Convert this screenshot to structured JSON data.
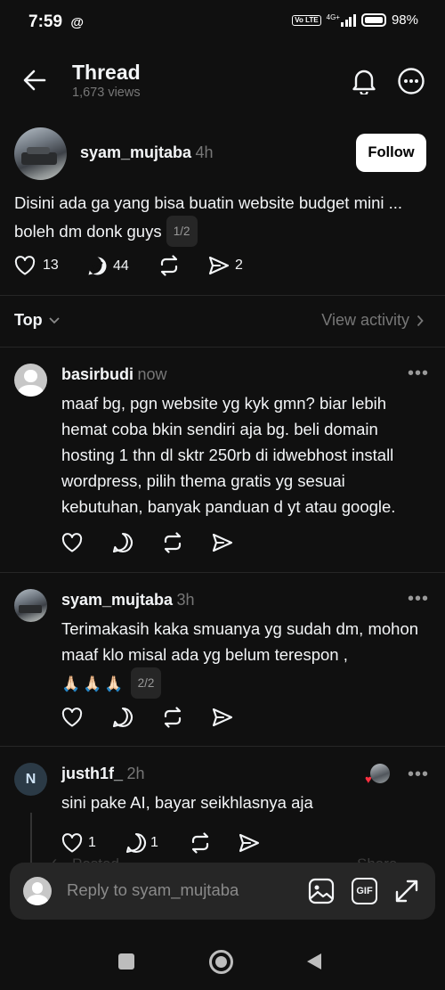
{
  "status_bar": {
    "time": "7:59",
    "network": "4G+",
    "volte": "Vo LTE",
    "battery": "98%"
  },
  "header": {
    "title": "Thread",
    "views": "1,673 views"
  },
  "post": {
    "username": "syam_mujtaba",
    "time": "4h",
    "follow_label": "Follow",
    "text": "Disini ada ga yang bisa buatin website budget mini ... boleh dm donk guys",
    "page_badge": "1/2",
    "likes": "13",
    "replies": "44",
    "shares": "2"
  },
  "sort": {
    "label": "Top",
    "view_activity": "View activity"
  },
  "comments": [
    {
      "username": "basirbudi",
      "time": "now",
      "text": "maaf bg, pgn website yg kyk gmn? biar lebih hemat coba bkin sendiri aja bg. beli domain hosting 1 thn dl sktr 250rb di idwebhost install wordpress, pilih thema gratis yg sesuai kebutuhan, banyak panduan d yt atau google."
    },
    {
      "username": "syam_mujtaba",
      "time": "3h",
      "text": "Terimakasih kaka smuanya yg sudah dm, mohon maaf klo misal ada yg belum terespon ,",
      "emoji": "🙏🏻🙏🏻🙏🏻",
      "page_badge": "2/2"
    },
    {
      "username": "justh1f_",
      "time": "2h",
      "text": "sini pake AI, bayar seikhlasnya aja",
      "likes": "1",
      "replies": "1"
    }
  ],
  "ghost_labels": {
    "posted": "Posted",
    "share": "Share"
  },
  "reply_bar": {
    "placeholder": "Reply to syam_mujtaba",
    "gif_label": "GIF"
  },
  "icons": [
    "back-arrow-icon",
    "bell-icon",
    "more-icon",
    "heart-icon",
    "reply-icon",
    "repost-icon",
    "share-icon",
    "chevron-down-icon",
    "chevron-right-icon",
    "image-icon",
    "gif-icon",
    "expand-icon"
  ]
}
